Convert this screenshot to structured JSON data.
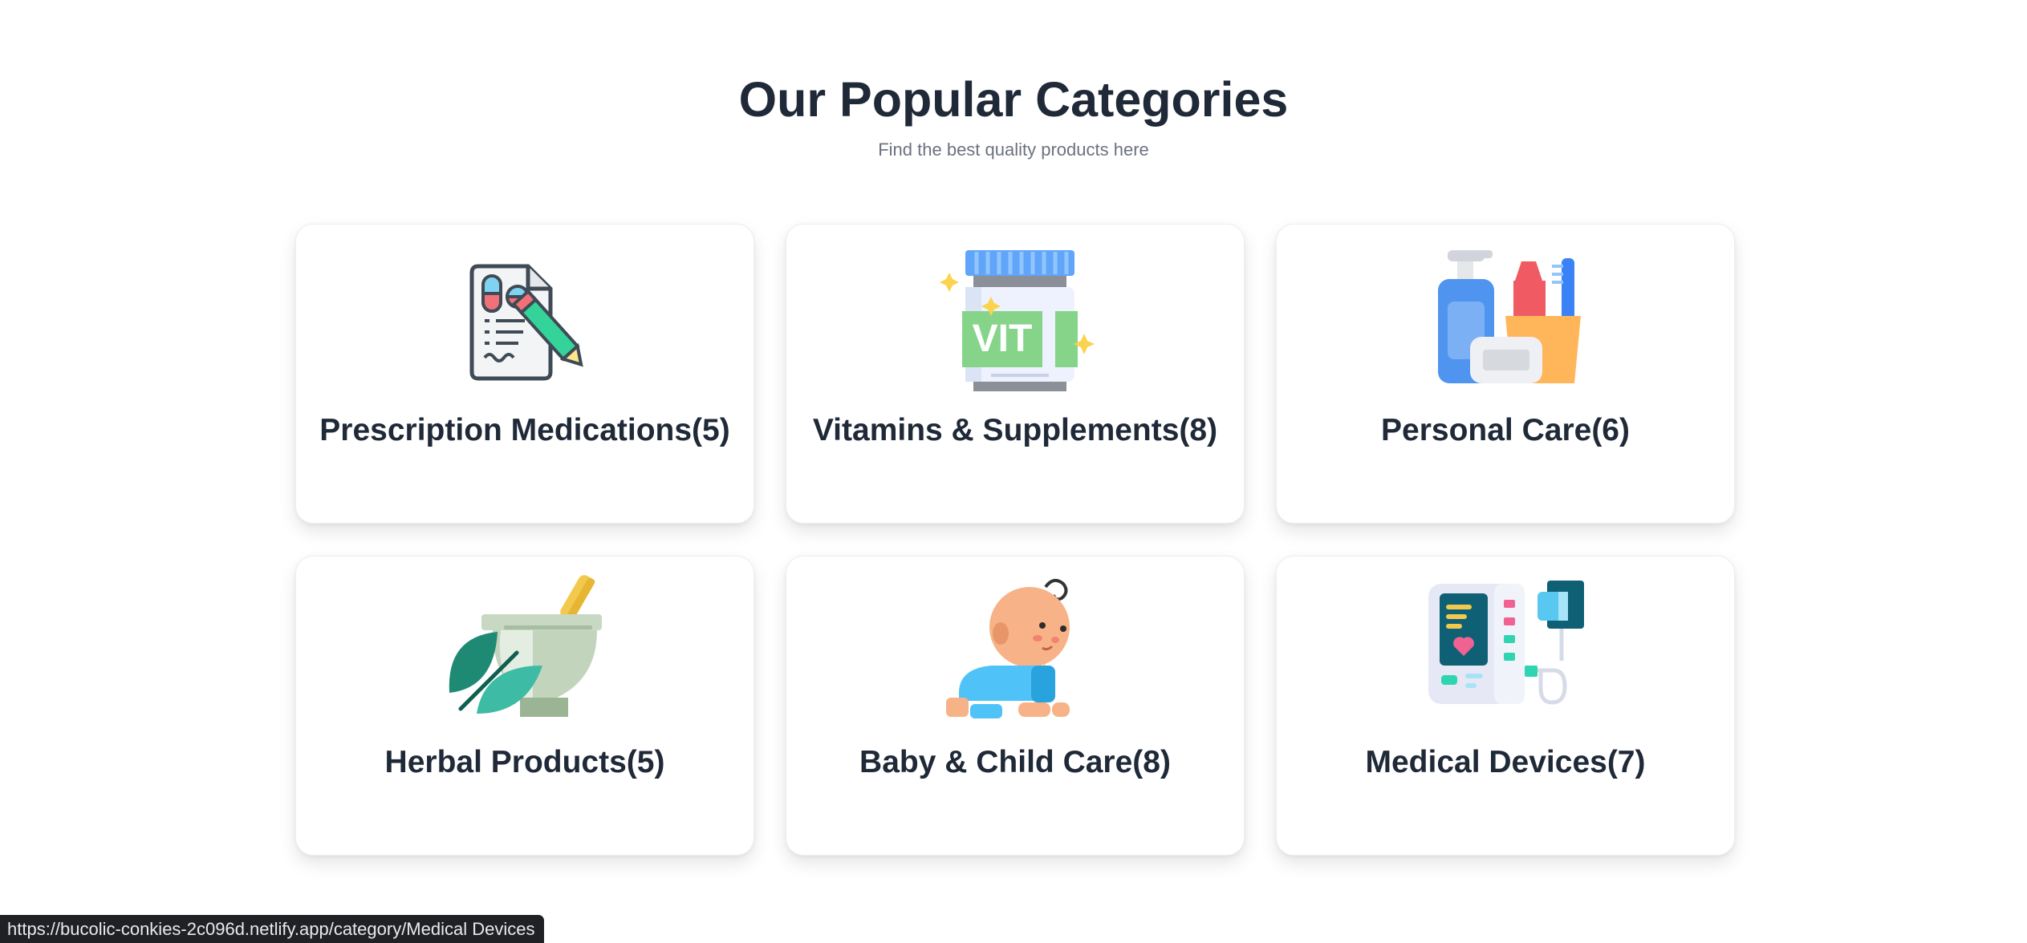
{
  "section": {
    "title": "Our Popular Categories",
    "subtitle": "Find the best quality products here"
  },
  "categories": [
    {
      "label": "Prescription Medications(5)",
      "icon": "prescription-icon"
    },
    {
      "label": "Vitamins & Supplements(8)",
      "icon": "vitamin-jar-icon"
    },
    {
      "label": "Personal Care(6)",
      "icon": "personal-care-icon"
    },
    {
      "label": "Herbal Products(5)",
      "icon": "mortar-pestle-herb-icon"
    },
    {
      "label": "Baby & Child Care(8)",
      "icon": "crawling-baby-icon"
    },
    {
      "label": "Medical Devices(7)",
      "icon": "blood-pressure-monitor-icon"
    }
  ],
  "status_bar": {
    "url": "https://bucolic-conkies-2c096d.netlify.app/category/Medical Devices"
  }
}
